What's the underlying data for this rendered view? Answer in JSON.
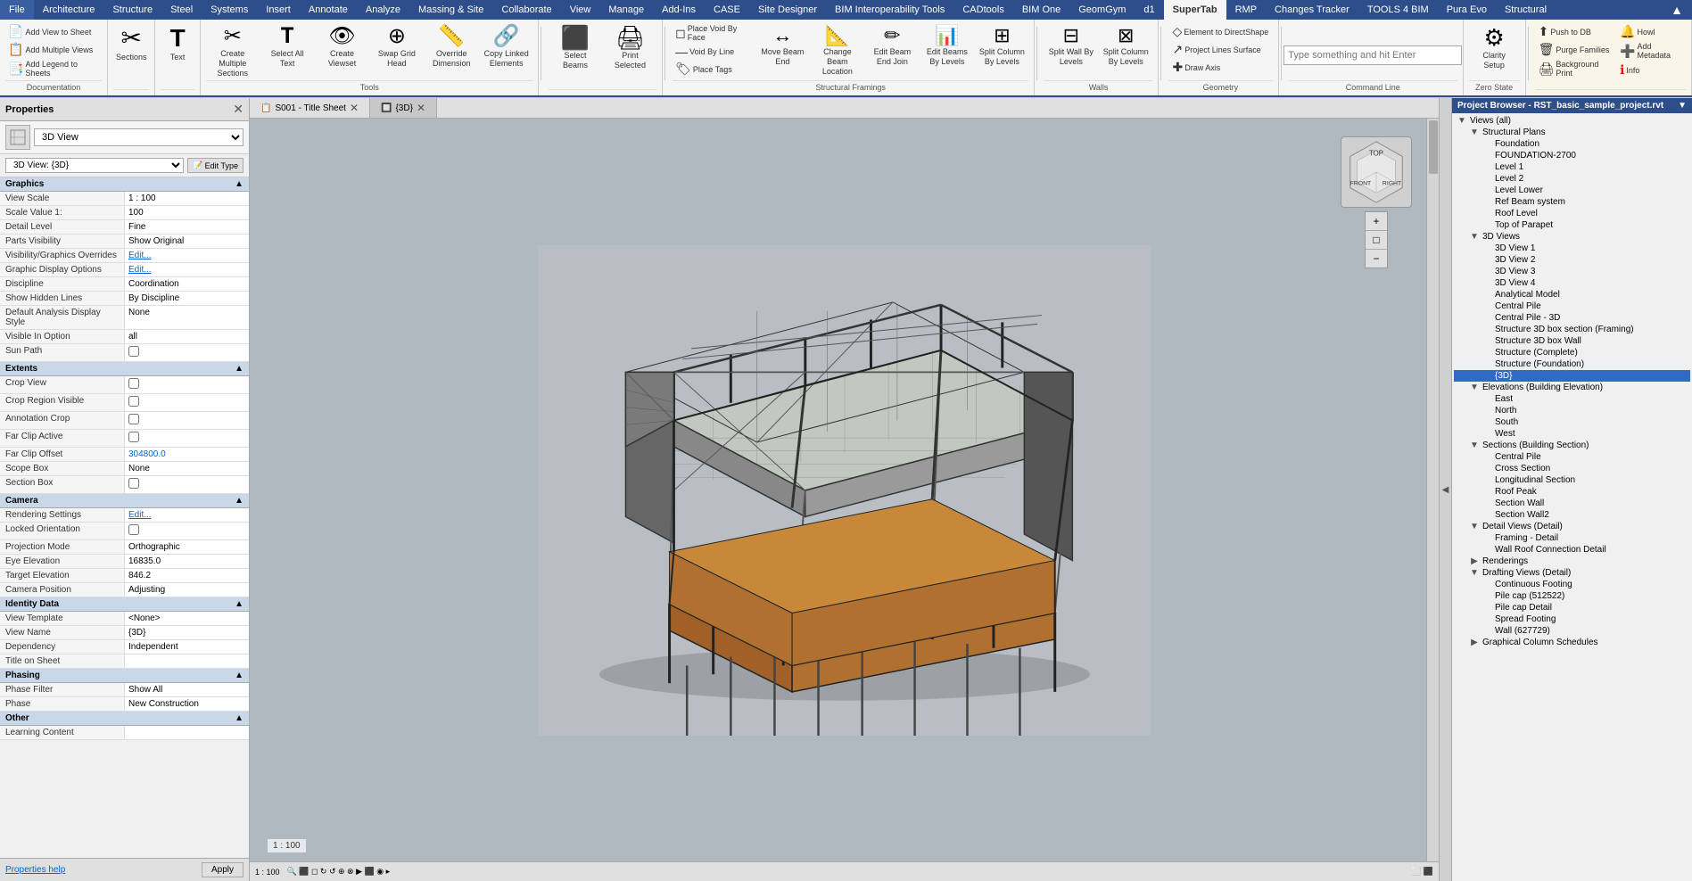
{
  "ribbon": {
    "tabs": [
      {
        "label": "File",
        "active": false
      },
      {
        "label": "Architecture",
        "active": false
      },
      {
        "label": "Structure",
        "active": false
      },
      {
        "label": "Steel",
        "active": false
      },
      {
        "label": "Systems",
        "active": false
      },
      {
        "label": "Insert",
        "active": false
      },
      {
        "label": "Annotate",
        "active": false
      },
      {
        "label": "Analyze",
        "active": false
      },
      {
        "label": "Massing & Site",
        "active": false
      },
      {
        "label": "Collaborate",
        "active": false
      },
      {
        "label": "View",
        "active": false
      },
      {
        "label": "Manage",
        "active": false
      },
      {
        "label": "Add-Ins",
        "active": false
      },
      {
        "label": "CASE",
        "active": false
      },
      {
        "label": "Site Designer",
        "active": false
      },
      {
        "label": "BIM Interoperability Tools",
        "active": false
      },
      {
        "label": "CADtools",
        "active": false
      },
      {
        "label": "BIM One",
        "active": false
      },
      {
        "label": "GeomGym",
        "active": false
      },
      {
        "label": "d1",
        "active": false
      },
      {
        "label": "SuperTab",
        "active": true
      },
      {
        "label": "RMP",
        "active": false
      },
      {
        "label": "Changes Tracker",
        "active": false
      },
      {
        "label": "TOOLS 4 BIM",
        "active": false
      },
      {
        "label": "Pura Evo",
        "active": false
      },
      {
        "label": "Structural",
        "active": false
      }
    ],
    "groups": {
      "documentation": {
        "label": "Documentation",
        "buttons": [
          {
            "label": "Add View to Sheet",
            "icon": "📄"
          },
          {
            "label": "Add Multiple Views",
            "icon": "📋"
          },
          {
            "label": "Add Legend to Sheets",
            "icon": "📑"
          }
        ]
      },
      "tools": {
        "label": "Tools",
        "buttons": [
          {
            "label": "Create Multiple Sections",
            "icon": "✂"
          },
          {
            "label": "Select All Text",
            "icon": "T"
          },
          {
            "label": "Create Viewset",
            "icon": "👁"
          },
          {
            "label": "Swap Grid Head",
            "icon": "⊕"
          },
          {
            "label": "Override Dimension",
            "icon": "📏"
          },
          {
            "label": "Copy Linked Elements",
            "icon": "🔗"
          }
        ]
      },
      "select_beams": {
        "label": "Select Beams",
        "buttons": [
          {
            "label": "Select Beams",
            "icon": "⬛"
          },
          {
            "label": "Print Selected",
            "icon": "🖨"
          }
        ]
      },
      "structural_framings": {
        "label": "Structural Framings",
        "buttons": [
          {
            "label": "Place Void By Face",
            "icon": "◻"
          },
          {
            "label": "Void By Line",
            "icon": "—"
          },
          {
            "label": "Place Tags",
            "icon": "🏷"
          },
          {
            "label": "Move Beam End",
            "icon": "↔"
          },
          {
            "label": "Change Beam Location",
            "icon": "📐"
          },
          {
            "label": "Edit Beam End Join",
            "icon": "✏"
          },
          {
            "label": "Edit Beams By Levels",
            "icon": "📊"
          },
          {
            "label": "Split Column By Levels",
            "icon": "⊞"
          }
        ]
      },
      "walls": {
        "label": "Walls",
        "buttons": [
          {
            "label": "Split Wall By Levels",
            "icon": "⊟"
          },
          {
            "label": "Split Column By Levels",
            "icon": "⊠"
          }
        ]
      },
      "geometry": {
        "label": "Geometry",
        "buttons": [
          {
            "label": "Element to DirectShape",
            "icon": "◇"
          },
          {
            "label": "Project Lines Surface",
            "icon": "↗"
          },
          {
            "label": "Draw Axis",
            "icon": "✚"
          }
        ]
      },
      "command_line": {
        "label": "Command Line",
        "placeholder": "Type something and hit Enter"
      },
      "zero_state": {
        "label": "Zero State",
        "buttons": [
          {
            "label": "Clarity Setup",
            "icon": "⚙"
          }
        ]
      },
      "supertab_group": {
        "label": "",
        "buttons": [
          {
            "label": "Push to DB",
            "icon": "⬆"
          },
          {
            "label": "Purge Families",
            "icon": "🗑"
          },
          {
            "label": "Background Print",
            "icon": "🖨"
          },
          {
            "label": "Howl",
            "icon": "🔔"
          },
          {
            "label": "Add Metadata",
            "icon": "➕"
          },
          {
            "label": "Info",
            "icon": "ℹ"
          }
        ]
      }
    }
  },
  "properties": {
    "title": "Properties",
    "type_label": "3D View",
    "view_name": "3D View: {3D}",
    "edit_type_label": "Edit Type",
    "sections": [
      {
        "name": "Graphics",
        "rows": [
          {
            "name": "View Scale",
            "value": "1 : 100"
          },
          {
            "name": "Scale Value 1:",
            "value": "100"
          },
          {
            "name": "Detail Level",
            "value": "Fine"
          },
          {
            "name": "Parts Visibility",
            "value": "Show Original"
          },
          {
            "name": "Visibility/Graphics Overrides",
            "value": "Edit...",
            "clickable": true
          },
          {
            "name": "Graphic Display Options",
            "value": "Edit...",
            "clickable": true
          },
          {
            "name": "Discipline",
            "value": "Coordination"
          },
          {
            "name": "Show Hidden Lines",
            "value": "By Discipline"
          },
          {
            "name": "Default Analysis Display Style",
            "value": "None"
          },
          {
            "name": "Visible In Option",
            "value": "all"
          },
          {
            "name": "Sun Path",
            "value": "",
            "checkbox": true
          }
        ]
      },
      {
        "name": "Extents",
        "rows": [
          {
            "name": "Crop View",
            "value": "",
            "checkbox": true
          },
          {
            "name": "Crop Region Visible",
            "value": "",
            "checkbox": true
          },
          {
            "name": "Annotation Crop",
            "value": "",
            "checkbox": true
          },
          {
            "name": "Far Clip Active",
            "value": "",
            "checkbox": true
          },
          {
            "name": "Far Clip Offset",
            "value": "304800.0"
          },
          {
            "name": "Scope Box",
            "value": "None"
          },
          {
            "name": "Section Box",
            "value": "",
            "checkbox": true
          }
        ]
      },
      {
        "name": "Camera",
        "rows": [
          {
            "name": "Rendering Settings",
            "value": "Edit...",
            "clickable": true
          },
          {
            "name": "Locked Orientation",
            "value": "",
            "checkbox": true
          },
          {
            "name": "Projection Mode",
            "value": "Orthographic"
          },
          {
            "name": "Eye Elevation",
            "value": "16835.0"
          },
          {
            "name": "Target Elevation",
            "value": "846.2"
          },
          {
            "name": "Camera Position",
            "value": "Adjusting"
          }
        ]
      },
      {
        "name": "Identity Data",
        "rows": [
          {
            "name": "View Template",
            "value": "<None>"
          },
          {
            "name": "View Name",
            "value": "{3D}"
          },
          {
            "name": "Dependency",
            "value": "Independent"
          },
          {
            "name": "Title on Sheet",
            "value": ""
          }
        ]
      },
      {
        "name": "Phasing",
        "rows": [
          {
            "name": "Phase Filter",
            "value": "Show All"
          },
          {
            "name": "Phase",
            "value": "New Construction"
          }
        ]
      },
      {
        "name": "Other",
        "rows": [
          {
            "name": "Learning Content",
            "value": ""
          }
        ]
      }
    ],
    "help_link": "Properties help",
    "apply_button": "Apply"
  },
  "view_tabs": [
    {
      "label": "S001 - Title Sheet",
      "active": false,
      "icon": "📋"
    },
    {
      "label": "{3D}",
      "active": true,
      "icon": "🔲"
    }
  ],
  "scale_bar": "1 : 100",
  "project_browser": {
    "title": "Project Browser - RST_basic_sample_project.rvt",
    "tree": [
      {
        "label": "Views (all)",
        "indent": 0,
        "expanded": true,
        "toggle": "▼"
      },
      {
        "label": "Structural Plans",
        "indent": 1,
        "expanded": true,
        "toggle": "▼"
      },
      {
        "label": "Foundation",
        "indent": 2,
        "toggle": ""
      },
      {
        "label": "FOUNDATION-2700",
        "indent": 2,
        "toggle": ""
      },
      {
        "label": "Level 1",
        "indent": 2,
        "toggle": ""
      },
      {
        "label": "Level 2",
        "indent": 2,
        "toggle": ""
      },
      {
        "label": "Level Lower",
        "indent": 2,
        "toggle": ""
      },
      {
        "label": "Ref Beam system",
        "indent": 2,
        "toggle": ""
      },
      {
        "label": "Roof Level",
        "indent": 2,
        "toggle": ""
      },
      {
        "label": "Top of Parapet",
        "indent": 2,
        "toggle": ""
      },
      {
        "label": "3D Views",
        "indent": 1,
        "expanded": true,
        "toggle": "▼"
      },
      {
        "label": "3D View 1",
        "indent": 2,
        "toggle": ""
      },
      {
        "label": "3D View 2",
        "indent": 2,
        "toggle": ""
      },
      {
        "label": "3D View 3",
        "indent": 2,
        "toggle": ""
      },
      {
        "label": "3D View 4",
        "indent": 2,
        "toggle": ""
      },
      {
        "label": "Analytical Model",
        "indent": 2,
        "toggle": ""
      },
      {
        "label": "Central Pile",
        "indent": 2,
        "toggle": ""
      },
      {
        "label": "Central Pile - 3D",
        "indent": 2,
        "toggle": ""
      },
      {
        "label": "Structure 3D box section (Framing)",
        "indent": 2,
        "toggle": ""
      },
      {
        "label": "Structure 3D box Wall",
        "indent": 2,
        "toggle": ""
      },
      {
        "label": "Structure (Complete)",
        "indent": 2,
        "toggle": ""
      },
      {
        "label": "Structure (Foundation)",
        "indent": 2,
        "toggle": ""
      },
      {
        "label": "{3D}",
        "indent": 2,
        "toggle": "",
        "selected": true
      },
      {
        "label": "Elevations (Building Elevation)",
        "indent": 1,
        "expanded": true,
        "toggle": "▼"
      },
      {
        "label": "East",
        "indent": 2,
        "toggle": ""
      },
      {
        "label": "North",
        "indent": 2,
        "toggle": ""
      },
      {
        "label": "South",
        "indent": 2,
        "toggle": ""
      },
      {
        "label": "West",
        "indent": 2,
        "toggle": ""
      },
      {
        "label": "Sections (Building Section)",
        "indent": 1,
        "expanded": true,
        "toggle": "▼"
      },
      {
        "label": "Central Pile",
        "indent": 2,
        "toggle": ""
      },
      {
        "label": "Cross Section",
        "indent": 2,
        "toggle": ""
      },
      {
        "label": "Longitudinal Section",
        "indent": 2,
        "toggle": ""
      },
      {
        "label": "Roof Peak",
        "indent": 2,
        "toggle": ""
      },
      {
        "label": "Section Wall",
        "indent": 2,
        "toggle": ""
      },
      {
        "label": "Section Wall2",
        "indent": 2,
        "toggle": ""
      },
      {
        "label": "Detail Views (Detail)",
        "indent": 1,
        "expanded": true,
        "toggle": "▼"
      },
      {
        "label": "Framing - Detail",
        "indent": 2,
        "toggle": ""
      },
      {
        "label": "Wall Roof Connection Detail",
        "indent": 2,
        "toggle": ""
      },
      {
        "label": "Renderings",
        "indent": 1,
        "expanded": false,
        "toggle": "▶"
      },
      {
        "label": "Drafting Views (Detail)",
        "indent": 1,
        "expanded": true,
        "toggle": "▼"
      },
      {
        "label": "Continuous Footing",
        "indent": 2,
        "toggle": ""
      },
      {
        "label": "Pile cap (512522)",
        "indent": 2,
        "toggle": ""
      },
      {
        "label": "Pile cap Detail",
        "indent": 2,
        "toggle": ""
      },
      {
        "label": "Spread Footing",
        "indent": 2,
        "toggle": ""
      },
      {
        "label": "Wall (627729)",
        "indent": 2,
        "toggle": ""
      },
      {
        "label": "Graphical Column Schedules",
        "indent": 1,
        "expanded": false,
        "toggle": "▶"
      }
    ]
  },
  "status_bar": {
    "scale": "1 : 100",
    "icons": [
      "🔍",
      "⬛",
      "◻",
      "↻",
      "↺",
      "⊕",
      "⊗",
      "▶",
      "⬛",
      "◉",
      "▸"
    ]
  }
}
